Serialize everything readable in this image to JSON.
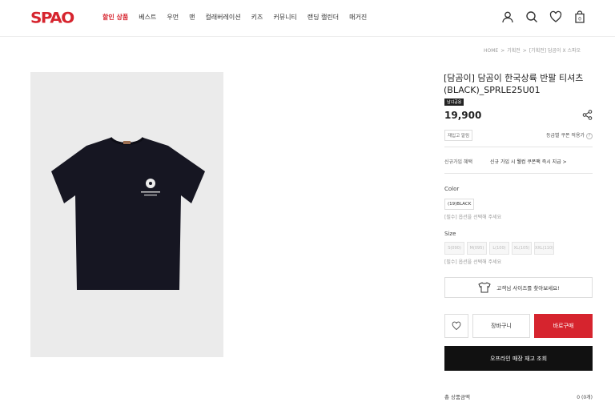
{
  "header": {
    "logo": "SPAO",
    "nav": [
      "할인 상품",
      "베스트",
      "우먼",
      "맨",
      "컬래버레이션",
      "키즈",
      "커뮤니티",
      "랜딩 캘린더",
      "매거진"
    ],
    "active_nav_index": 0,
    "icons": [
      "user-icon",
      "search-icon",
      "heart-icon",
      "cart-icon"
    ],
    "cart_count": "0"
  },
  "breadcrumb": [
    "HOME",
    "기획전",
    "[기획전] 담곰이 X 스파오"
  ],
  "product": {
    "title": "[담곰이] 담곰이 한국상륙 반팔 티셔츠 (BLACK)_SPRLE25U01",
    "badge": "남녀공용",
    "price": "19,900",
    "restock_tag": "재입고 알림",
    "coupon_text": "등급별 쿠폰 적용가",
    "coupon_help": "?",
    "member_label": "신규가입 혜택",
    "member_text": "신규 가입 시 웰컴 쿠폰팩 즉시 지급 >",
    "color_label": "Color",
    "color_option": "(19)BLACK",
    "color_hint": "[필수] 옵션을 선택해 주세요",
    "size_label": "Size",
    "sizes": [
      "S(090)",
      "M(095)",
      "L(100)",
      "XL(105)",
      "XXL(110)"
    ],
    "size_hint": "[필수] 옵션을 선택해 주세요",
    "size_finder_text": "고객님 사이즈를 찾아보세요!",
    "cart_label": "장바구니",
    "buy_label": "바로구매",
    "stock_label": "오프라인 매장 재고 조회",
    "total_label": "총 상품금액",
    "total_value": "0 (0개)"
  },
  "colors": {
    "accent": "#d6242e",
    "dark": "#111111",
    "shirt": "#161622",
    "image_bg": "#ebebeb"
  }
}
